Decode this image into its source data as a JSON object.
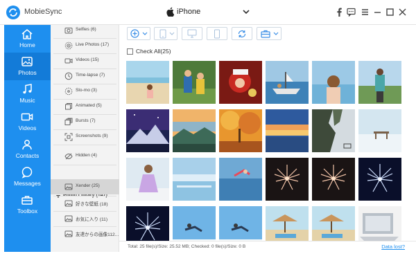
{
  "app": {
    "name": "MobieSync",
    "logo_icon": "sync-arrows-logo",
    "accent": "#1e8fef"
  },
  "device": {
    "name": "iPhone",
    "icon": "apple-icon"
  },
  "titlebar_icons": [
    "facebook-icon",
    "chat-icon",
    "menu-icon",
    "minimize-icon",
    "maximize-icon",
    "close-icon"
  ],
  "sidebar": {
    "active": "Photos",
    "items": [
      {
        "label": "Home",
        "icon": "home-icon"
      },
      {
        "label": "Photos",
        "icon": "photos-icon"
      },
      {
        "label": "Music",
        "icon": "music-icon"
      },
      {
        "label": "Videos",
        "icon": "video-icon"
      },
      {
        "label": "Contacts",
        "icon": "contacts-icon"
      },
      {
        "label": "Messages",
        "icon": "messages-icon"
      },
      {
        "label": "Toolbox",
        "icon": "toolbox-icon"
      }
    ]
  },
  "albums": {
    "items": [
      {
        "label": "Selfies (6)",
        "icon": "selfie-icon"
      },
      {
        "label": "Live Photos (17)",
        "icon": "live-photo-icon"
      },
      {
        "label": "Videos (15)",
        "icon": "video-icon"
      },
      {
        "label": "Time-lapse (7)",
        "icon": "timelapse-icon"
      },
      {
        "label": "Slo-mo (3)",
        "icon": "slomo-icon"
      },
      {
        "label": "Animated (5)",
        "icon": "animated-icon"
      },
      {
        "label": "Bursts (7)",
        "icon": "bursts-icon"
      },
      {
        "label": "Screenshots (9)",
        "icon": "screenshot-icon"
      },
      {
        "label": "Hidden (4)",
        "icon": "hidden-icon"
      }
    ],
    "library_header": "Photo Library (147)",
    "library_items": [
      {
        "label": "Xender (25)",
        "icon": "album-icon",
        "active": true
      },
      {
        "label": "好きな壁紙 (18)",
        "icon": "album-icon"
      },
      {
        "label": "お気に入り (11)",
        "icon": "album-icon"
      },
      {
        "label": "友達からの画像112...",
        "icon": "album-icon"
      }
    ]
  },
  "toolbar": {
    "buttons": [
      "add-icon",
      "export-to-device-icon",
      "export-to-pc-icon",
      "delete-icon",
      "refresh-icon",
      "toolbox-dropdown-icon"
    ]
  },
  "check_all": {
    "label": "Check All(25)",
    "checked": false
  },
  "photos": [
    {
      "scene": "beach-girl"
    },
    {
      "scene": "kids-park"
    },
    {
      "scene": "christmas"
    },
    {
      "scene": "boat-sea"
    },
    {
      "scene": "woman-sea"
    },
    {
      "scene": "hiker"
    },
    {
      "scene": "night-mountain"
    },
    {
      "scene": "valley-sunset"
    },
    {
      "scene": "autumn-forest"
    },
    {
      "scene": "sunset-clouds"
    },
    {
      "scene": "cliff"
    },
    {
      "scene": "snow-bench"
    },
    {
      "scene": "girl-dress"
    },
    {
      "scene": "icy-lake"
    },
    {
      "scene": "dancer-lake"
    },
    {
      "scene": "fireworks-red"
    },
    {
      "scene": "fireworks-red"
    },
    {
      "scene": "fireworks-blue"
    },
    {
      "scene": "fireworks-blue"
    },
    {
      "scene": "snow-jump"
    },
    {
      "scene": "snow-jump"
    },
    {
      "scene": "beach-umbrella"
    },
    {
      "scene": "beach-umbrella"
    },
    {
      "scene": "laptop"
    }
  ],
  "status": {
    "text": "Total: 25 file(s)/Size: 25.52 MB; Checked: 0 file(s)/Size: 0 B",
    "data_lost": "Data lost?"
  }
}
